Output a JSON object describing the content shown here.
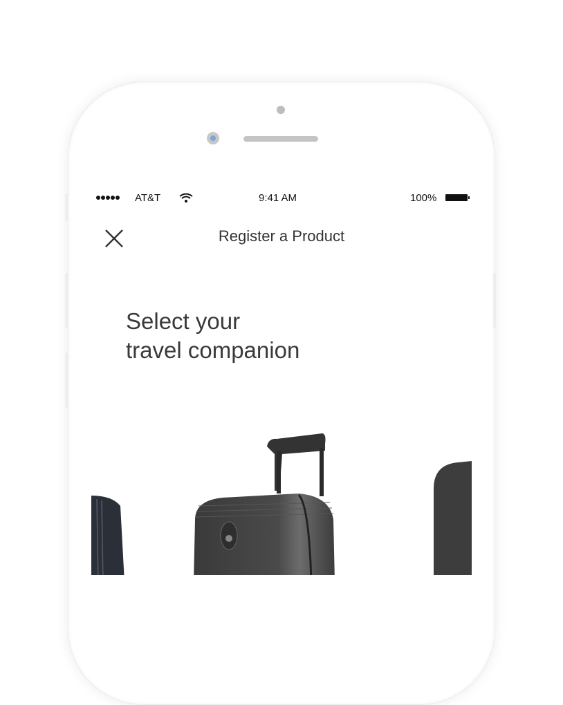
{
  "status_bar": {
    "carrier": "AT&T",
    "time": "9:41 AM",
    "battery": "100%",
    "signal_bars": 5
  },
  "nav": {
    "title": "Register a Product",
    "close_icon": "close-icon"
  },
  "main": {
    "heading_line1": "Select your",
    "heading_line2": "travel companion"
  },
  "carousel": {
    "items": [
      "suitcase-left",
      "suitcase-center",
      "suitcase-right"
    ]
  }
}
